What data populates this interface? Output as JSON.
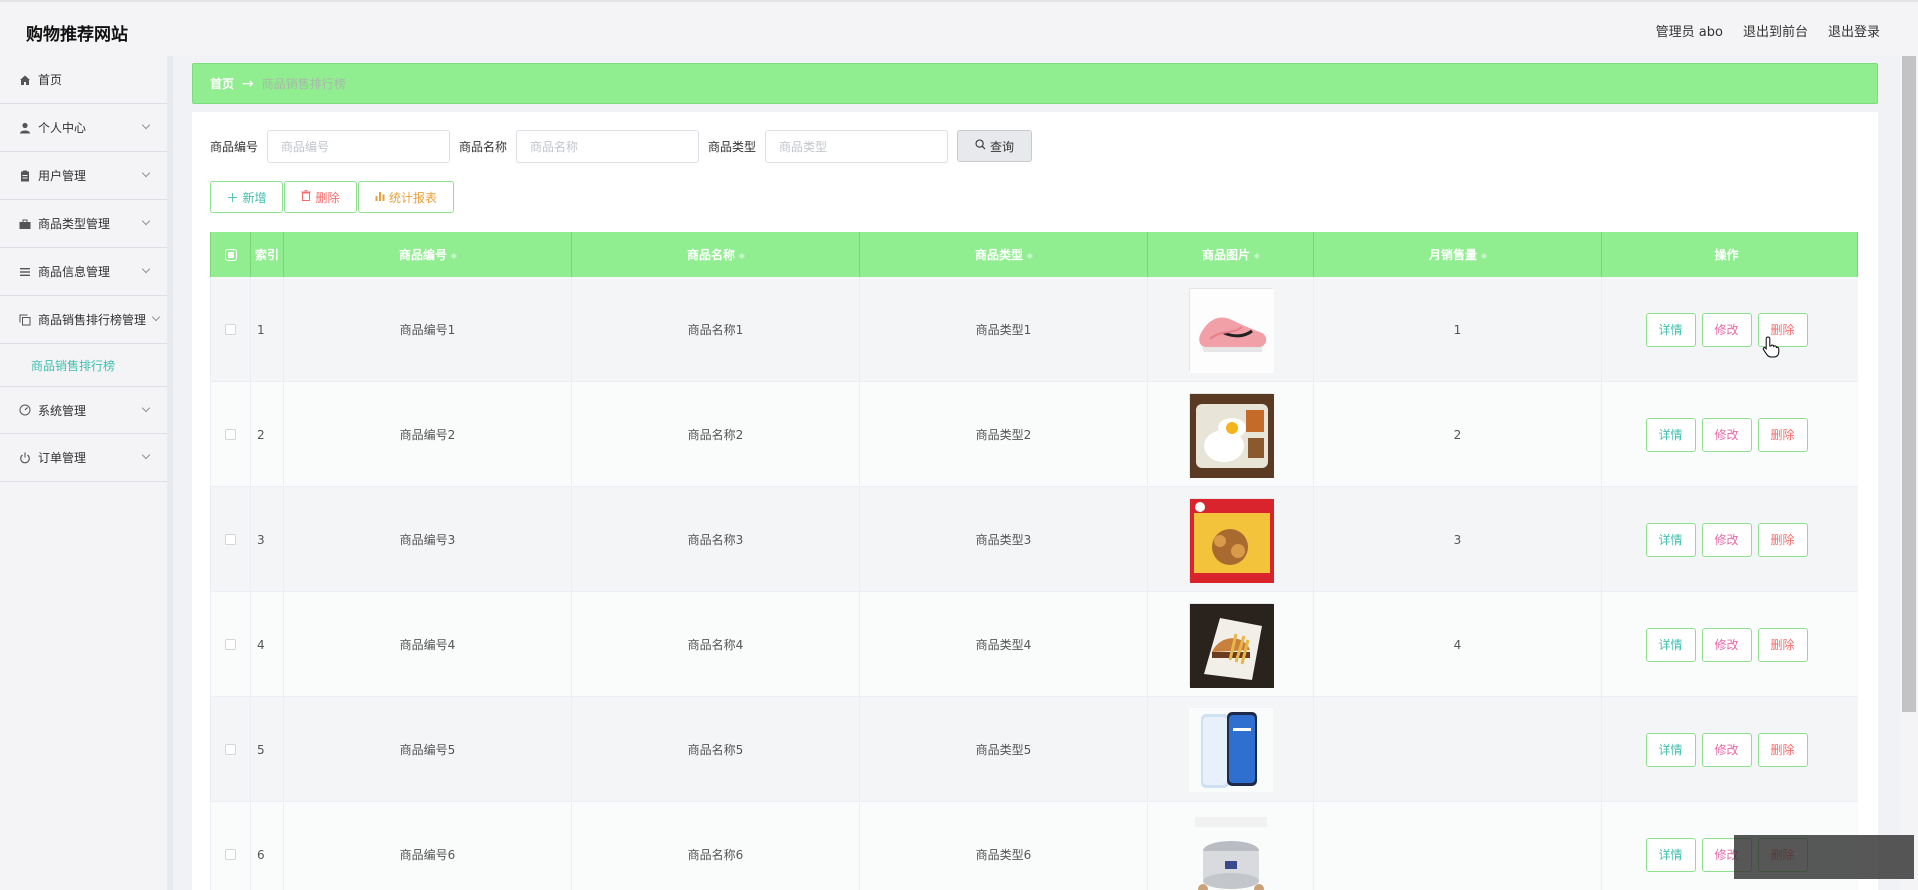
{
  "header": {
    "site_title": "购物推荐网站",
    "admin_label": "管理员 abo",
    "to_front": "退出到前台",
    "logout": "退出登录"
  },
  "sidebar": {
    "items": [
      {
        "label": "首页",
        "icon": "home-icon",
        "has_arrow": false
      },
      {
        "label": "个人中心",
        "icon": "user-icon",
        "has_arrow": true
      },
      {
        "label": "用户管理",
        "icon": "clipboard-icon",
        "has_arrow": true
      },
      {
        "label": "商品类型管理",
        "icon": "briefcase-icon",
        "has_arrow": true
      },
      {
        "label": "商品信息管理",
        "icon": "list-icon",
        "has_arrow": true
      },
      {
        "label": "商品销售排行榜管理",
        "icon": "copy-icon",
        "has_arrow": true
      },
      {
        "label": "商品销售排行榜",
        "is_sub": true
      },
      {
        "label": "系统管理",
        "icon": "dashboard-icon",
        "has_arrow": true
      },
      {
        "label": "订单管理",
        "icon": "power-icon",
        "has_arrow": true
      }
    ]
  },
  "breadcrumb": {
    "home": "首页",
    "arrow": "→",
    "current": "商品销售排行榜"
  },
  "search": {
    "fields": [
      {
        "label": "商品编号",
        "placeholder": "商品编号"
      },
      {
        "label": "商品名称",
        "placeholder": "商品名称"
      },
      {
        "label": "商品类型",
        "placeholder": "商品类型"
      }
    ],
    "query_label": "查询"
  },
  "actions": {
    "add": "新增",
    "delete": "删除",
    "stats": "统计报表"
  },
  "table": {
    "columns": [
      "索引",
      "商品编号",
      "商品名称",
      "商品类型",
      "商品图片",
      "月销售量",
      "操作"
    ],
    "rows": [
      {
        "index": "1",
        "code": "商品编号1",
        "name": "商品名称1",
        "type": "商品类型1",
        "image": "pink-sneaker",
        "sales": "1"
      },
      {
        "index": "2",
        "code": "商品编号2",
        "name": "商品名称2",
        "type": "商品类型2",
        "image": "bento-rice",
        "sales": "2"
      },
      {
        "index": "3",
        "code": "商品编号3",
        "name": "商品名称3",
        "type": "商品类型3",
        "image": "snack-box",
        "sales": "3"
      },
      {
        "index": "4",
        "code": "商品编号4",
        "name": "商品名称4",
        "type": "商品类型4",
        "image": "burger-fries",
        "sales": "4"
      },
      {
        "index": "5",
        "code": "商品编号5",
        "name": "商品名称5",
        "type": "商品类型5",
        "image": "smartphone",
        "sales": ""
      },
      {
        "index": "6",
        "code": "商品编号6",
        "name": "商品名称6",
        "type": "商品类型6",
        "image": "rice-cooker",
        "sales": ""
      }
    ],
    "row_buttons": {
      "detail": "详情",
      "edit": "修改",
      "remove": "删除"
    }
  },
  "colors": {
    "accent_green": "#90ee90",
    "teal_text": "#3fbfb0",
    "danger": "#f56c6c",
    "warning": "#e6a23c"
  }
}
